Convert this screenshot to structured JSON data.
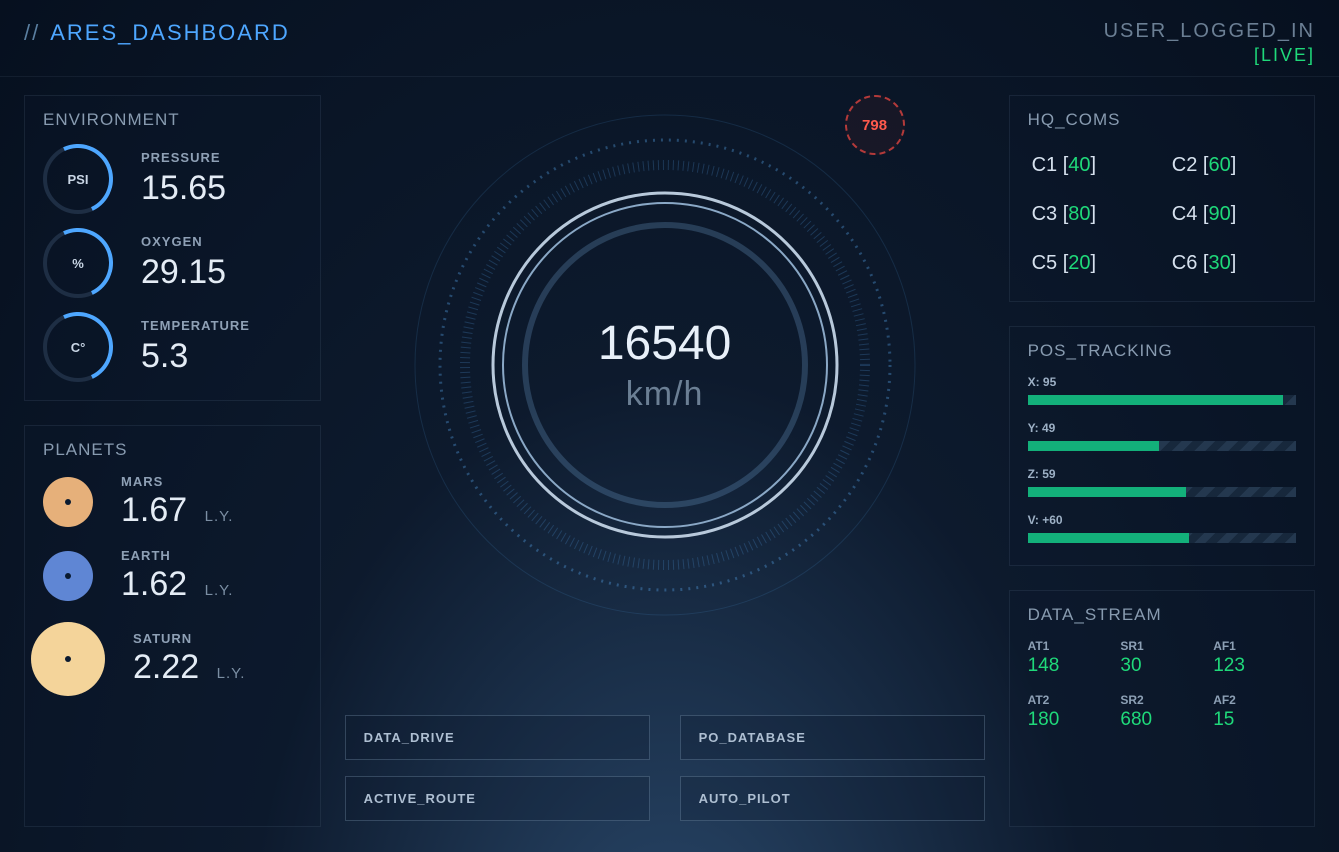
{
  "header": {
    "slashes": "//",
    "title": "ARES_DASHBOARD",
    "user_status": "USER_LOGGED_IN",
    "live_label": "[LIVE]"
  },
  "environment": {
    "title": "ENVIRONMENT",
    "items": [
      {
        "unit": "PSI",
        "label": "PRESSURE",
        "value": "15.65"
      },
      {
        "unit": "%",
        "label": "OXYGEN",
        "value": "29.15"
      },
      {
        "unit": "C°",
        "label": "TEMPERATURE",
        "value": "5.3"
      }
    ]
  },
  "planets": {
    "title": "PLANETS",
    "unit": "L.Y.",
    "items": [
      {
        "name": "MARS",
        "value": "1.67",
        "color": "#e6b07a",
        "size": 50
      },
      {
        "name": "EARTH",
        "value": "1.62",
        "color": "#5f86d4",
        "size": 50
      },
      {
        "name": "SATURN",
        "value": "2.22",
        "color": "#f4d49a",
        "size": 74
      }
    ]
  },
  "gauge": {
    "speed": "16540",
    "unit": "km/h",
    "badge": "798"
  },
  "buttons": {
    "data_drive": "DATA_DRIVE",
    "po_database": "PO_DATABASE",
    "active_route": "ACTIVE_ROUTE",
    "auto_pilot": "AUTO_PILOT"
  },
  "hq_coms": {
    "title": "HQ_COMS",
    "items": [
      {
        "label": "C1",
        "value": "40"
      },
      {
        "label": "C2",
        "value": "60"
      },
      {
        "label": "C3",
        "value": "80"
      },
      {
        "label": "C4",
        "value": "90"
      },
      {
        "label": "C5",
        "value": "20"
      },
      {
        "label": "C6",
        "value": "30"
      }
    ]
  },
  "pos_tracking": {
    "title": "POS_TRACKING",
    "rows": [
      {
        "label": "X: 95",
        "pct": 95
      },
      {
        "label": "Y: 49",
        "pct": 49
      },
      {
        "label": "Z: 59",
        "pct": 59
      },
      {
        "label": "V: +60",
        "pct": 60
      }
    ]
  },
  "data_stream": {
    "title": "DATA_STREAM",
    "cells": [
      {
        "label": "AT1",
        "value": "148"
      },
      {
        "label": "SR1",
        "value": "30"
      },
      {
        "label": "AF1",
        "value": "123"
      },
      {
        "label": "AT2",
        "value": "180"
      },
      {
        "label": "SR2",
        "value": "680"
      },
      {
        "label": "AF2",
        "value": "15"
      }
    ]
  },
  "colors": {
    "accent_blue": "#4ea7ff",
    "accent_green": "#1fd97a",
    "danger": "#ff5a4d"
  }
}
